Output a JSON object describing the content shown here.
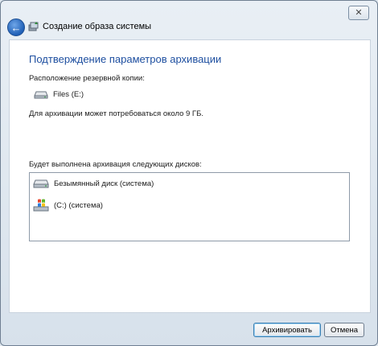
{
  "window": {
    "title": "Создание образа системы",
    "close_symbol": "✕",
    "back_icon": "back-arrow-icon"
  },
  "page": {
    "heading": "Подтверждение параметров архивации",
    "backup_location_label": "Расположение резервной копии:",
    "backup_drive": "Files (E:)",
    "space_note": "Для архивации может потребоваться около 9 ГБ.",
    "disks_label": "Будет выполнена архивация следующих дисков:",
    "disks": [
      {
        "label": "Безымянный диск (система)",
        "icon": "hard-drive-icon"
      },
      {
        "label": "(C:) (система)",
        "icon": "windows-drive-icon"
      }
    ]
  },
  "buttons": {
    "start": "Архивировать",
    "cancel": "Отмена"
  },
  "colors": {
    "heading": "#1e4fa0",
    "accent": "#1f5fb6"
  }
}
